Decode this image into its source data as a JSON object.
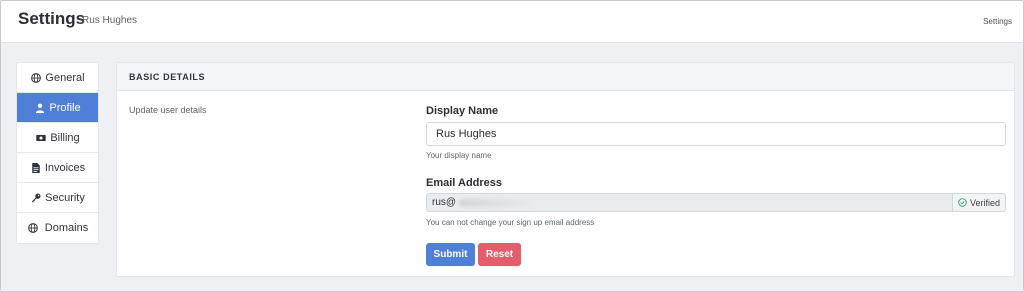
{
  "header": {
    "title": "Settings",
    "subtitle": "Rus Hughes",
    "breadcrumb": "Settings"
  },
  "sidebar": {
    "items": [
      {
        "label": "General",
        "icon": "globe-icon",
        "active": false
      },
      {
        "label": "Profile",
        "icon": "user-icon",
        "active": true
      },
      {
        "label": "Billing",
        "icon": "money-bill-icon",
        "active": false
      },
      {
        "label": "Invoices",
        "icon": "file-icon",
        "active": false
      },
      {
        "label": "Security",
        "icon": "key-icon",
        "active": false
      },
      {
        "label": "Domains",
        "icon": "globe-icon",
        "active": false
      }
    ]
  },
  "card": {
    "heading": "BASIC DETAILS",
    "description": "Update user details",
    "display_name": {
      "label": "Display Name",
      "value": "Rus Hughes",
      "help": "Your display name"
    },
    "email": {
      "label": "Email Address",
      "value": "rus@",
      "status": "Verified",
      "help": "You can not change your sign up email address"
    },
    "submit_label": "Submit",
    "reset_label": "Reset"
  },
  "colors": {
    "accent": "#4f7fd6",
    "danger": "#e35d6a",
    "verified": "#2fa36b"
  }
}
